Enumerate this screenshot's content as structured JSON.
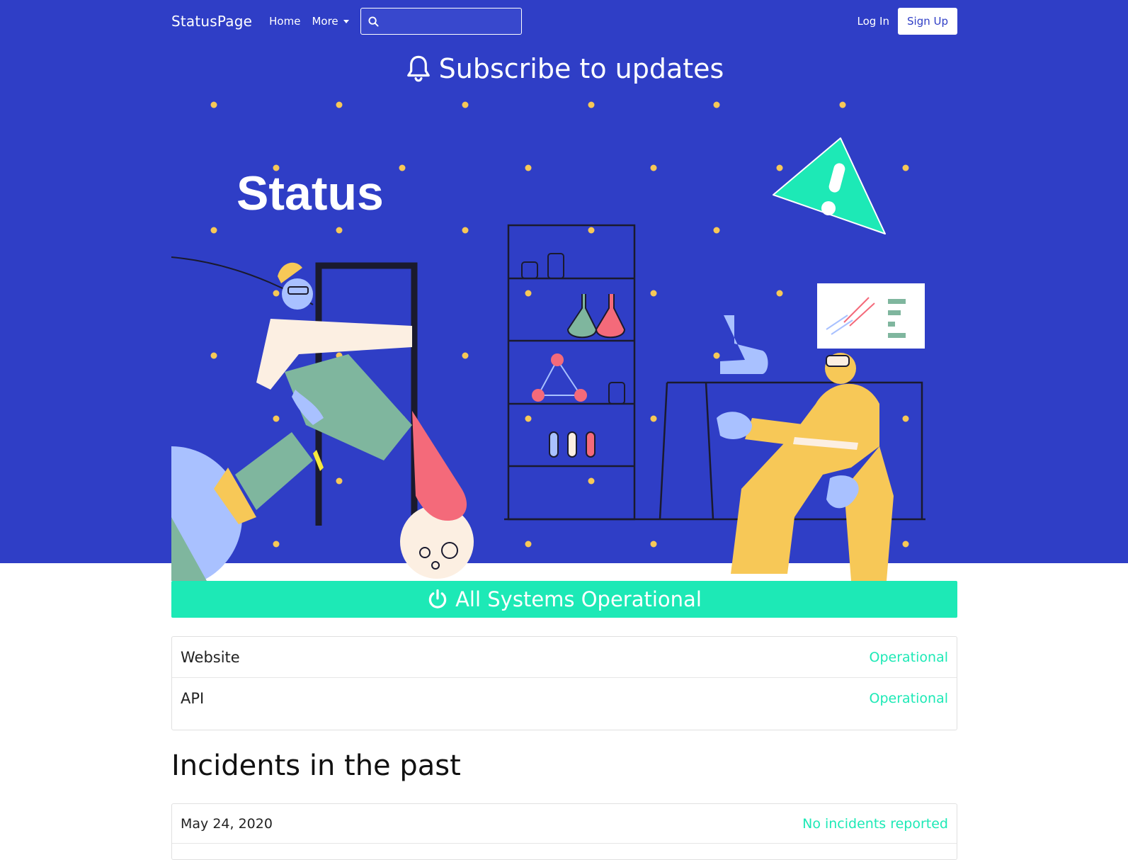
{
  "navbar": {
    "brand": "StatusPage",
    "links": {
      "home": "Home",
      "more": "More"
    },
    "search": {
      "value": "",
      "placeholder": ""
    },
    "login": "Log In",
    "signup": "Sign Up"
  },
  "subscribe": {
    "label": "Subscribe to updates",
    "icon": "bell-icon"
  },
  "hero": {
    "title": "Status"
  },
  "banner": {
    "label": "All Systems Operational",
    "icon": "power-icon",
    "color": "#1de9b6"
  },
  "components": [
    {
      "name": "Website",
      "status": "Operational"
    },
    {
      "name": "API",
      "status": "Operational"
    }
  ],
  "incidents": {
    "title": "Incidents in the past",
    "days": [
      {
        "date": "May 24, 2020",
        "status": "No incidents reported"
      }
    ]
  },
  "colors": {
    "primary": "#2f3ec6",
    "accent": "#1de9b6",
    "dots": "#f7c857"
  }
}
